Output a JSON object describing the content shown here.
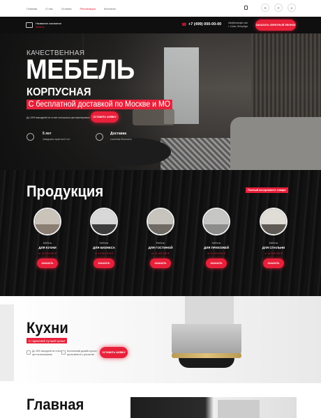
{
  "nav": {
    "links": [
      {
        "label": "Главная",
        "active": false
      },
      {
        "label": "О нас",
        "active": false
      },
      {
        "label": "Отзывы",
        "active": false
      },
      {
        "label": "Реализации",
        "active": true
      },
      {
        "label": "Контакты",
        "active": false
      }
    ],
    "icons": [
      "cart-icon",
      "circle-icon-1",
      "circle-icon-2",
      "circle-icon-3"
    ]
  },
  "header": {
    "company_name": "Название компании",
    "company_sub": "Мебель",
    "phone": "+7 (499) 000-00-00",
    "email": "info@example.com",
    "city": "г. Санкт-Петербург",
    "callback_label": "ЗАКАЗАТЬ ОБРАТНЫЙ ЗВОНОК"
  },
  "hero": {
    "kicker": "КАЧЕСТВЕННАЯ",
    "title": "МЕБЕЛЬ",
    "subtitle": "КОРПУСНАЯ",
    "highlight": "С бесплатной доставкой по Москве и МО",
    "discount_text": "До 15% выгодней не стоит сплошных цен мастеровых",
    "cta_label": "ОСТАВИТЬ ЗАЯВКУ",
    "features": [
      {
        "icon": "badge-icon",
        "title": "5 лет",
        "text": "Заводская гарантия 5 лет"
      },
      {
        "icon": "truck-icon",
        "title": "Доставка",
        "text": "и монтаж бесплатно"
      }
    ]
  },
  "products": {
    "title": "Продукция",
    "assortment_badge": "Полный ассортимент товара",
    "items": [
      {
        "label1": "Мебель",
        "label2": "ДЛЯ КУХНИ",
        "price": "от 15 515 000 ₽",
        "button": "ЗАКАЗАТЬ",
        "colors": [
          "#c9c3b9",
          "#8a7f72"
        ]
      },
      {
        "label1": "Мебель",
        "label2": "ДЛЯ БИЗНЕСА",
        "price": "от 10 510 000 ₽",
        "button": "ЗАКАЗАТЬ",
        "colors": [
          "#d8d8d8",
          "#3c3c3c"
        ]
      },
      {
        "label1": "Мебель",
        "label2": "ДЛЯ ГОСТИНОЙ",
        "price": "от 16 500 000 ₽",
        "button": "ЗАКАЗАТЬ",
        "colors": [
          "#c7c4be",
          "#6f6a63"
        ]
      },
      {
        "label1": "Мебель",
        "label2": "ДЛЯ ПРИХОЖЕЙ",
        "price": "от 14 515 000 ₽",
        "button": "ЗАКАЗАТЬ",
        "colors": [
          "#c6c6c4",
          "#8c8c8a"
        ]
      },
      {
        "label1": "Мебель",
        "label2": "ДЛЯ СПАЛЬНИ",
        "price": "от 16 595 000 ₽",
        "button": "ЗАКАЗАТЬ",
        "colors": [
          "#e0ddd7",
          "#5f5a54"
        ]
      }
    ]
  },
  "kitchens": {
    "title": "Кухни",
    "subtitle": "С гарантией лучшей цены!",
    "text1": "До 15% выгодней не стоит цен на материалы",
    "text2": "Бесплатный дизайн-проект кухни вместе с расчетом",
    "cta_label": "ОСТАВИТЬ ЗАЯВКУ"
  },
  "bottom": {
    "title": "Главная"
  },
  "colors": {
    "accent": "#e8203a",
    "dark": "#0f0f10"
  }
}
